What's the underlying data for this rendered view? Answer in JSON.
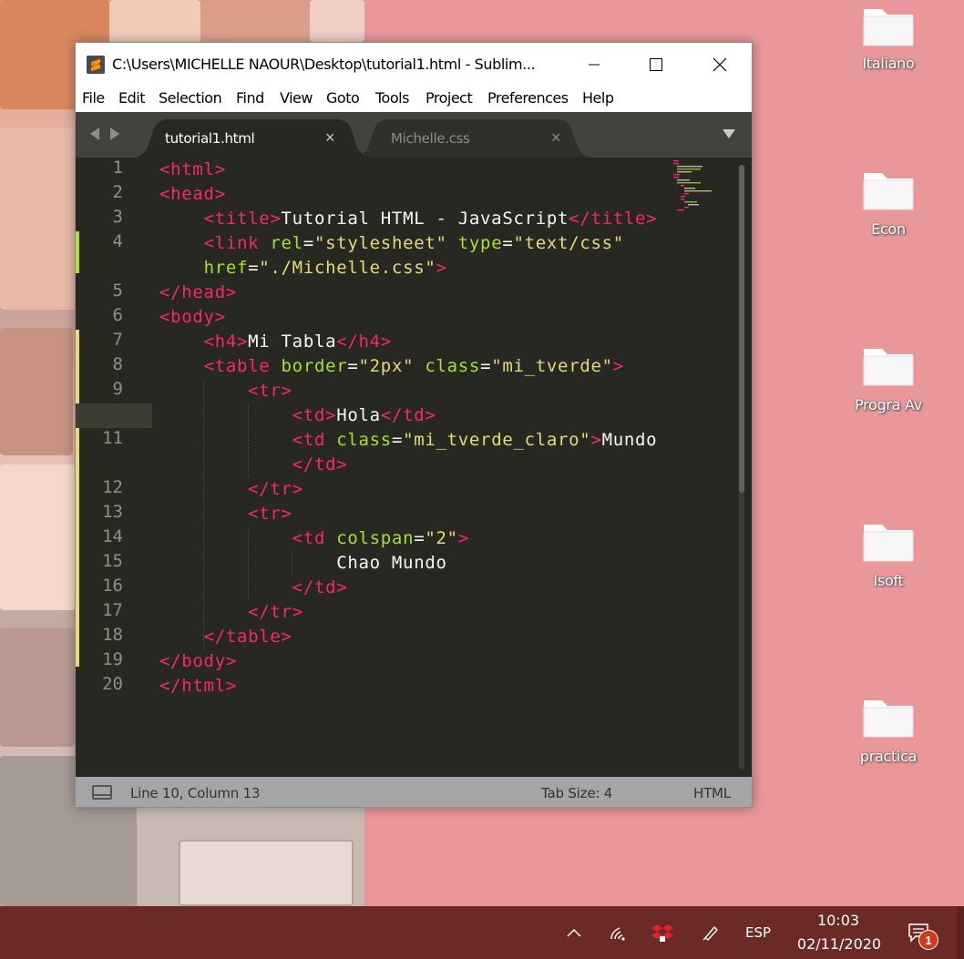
{
  "window": {
    "title": "C:\\Users\\MICHELLE NAOUR\\Desktop\\tutorial1.html - Sublim...",
    "menu": [
      "File",
      "Edit",
      "Selection",
      "Find",
      "View",
      "Goto",
      "Tools",
      "Project",
      "Preferences",
      "Help"
    ]
  },
  "tabs": [
    {
      "label": "tutorial1.html",
      "active": true
    },
    {
      "label": "Michelle.css",
      "active": false
    }
  ],
  "editor": {
    "line_numbers": [
      "1",
      "2",
      "3",
      "4",
      "",
      "5",
      "6",
      "7",
      "8",
      "9",
      "10",
      "11",
      "",
      "12",
      "13",
      "14",
      "15",
      "16",
      "17",
      "18",
      "19",
      "20"
    ],
    "current_line": "10",
    "lines": [
      [
        [
          "tag",
          "<"
        ],
        [
          "tagname",
          "html"
        ],
        [
          "tag",
          ">"
        ]
      ],
      [
        [
          "tag",
          "<"
        ],
        [
          "tagname",
          "head"
        ],
        [
          "tag",
          ">"
        ]
      ],
      [
        [
          "txt",
          "    "
        ],
        [
          "tag",
          "<"
        ],
        [
          "tagname",
          "title"
        ],
        [
          "tag",
          ">"
        ],
        [
          "txt",
          "Tutorial HTML - JavaScript"
        ],
        [
          "tag",
          "</"
        ],
        [
          "tagname",
          "title"
        ],
        [
          "tag",
          ">"
        ]
      ],
      [
        [
          "txt",
          "    "
        ],
        [
          "tag",
          "<"
        ],
        [
          "tagname",
          "link"
        ],
        [
          "txt",
          " "
        ],
        [
          "attr",
          "rel"
        ],
        [
          "txt",
          "="
        ],
        [
          "str",
          "\"stylesheet\""
        ],
        [
          "txt",
          " "
        ],
        [
          "attr",
          "type"
        ],
        [
          "txt",
          "="
        ],
        [
          "str",
          "\"text/css\""
        ]
      ],
      [
        [
          "txt",
          "    "
        ],
        [
          "attr",
          "href"
        ],
        [
          "txt",
          "="
        ],
        [
          "str",
          "\"./Michelle.css\""
        ],
        [
          "tag",
          ">"
        ]
      ],
      [
        [
          "tag",
          "</"
        ],
        [
          "tagname",
          "head"
        ],
        [
          "tag",
          ">"
        ]
      ],
      [
        [
          "tag",
          "<"
        ],
        [
          "tagname",
          "body"
        ],
        [
          "tag",
          ">"
        ]
      ],
      [
        [
          "txt",
          "    "
        ],
        [
          "tag",
          "<"
        ],
        [
          "tagname",
          "h4"
        ],
        [
          "tag",
          ">"
        ],
        [
          "txt",
          "Mi Tabla"
        ],
        [
          "tag",
          "</"
        ],
        [
          "tagname",
          "h4"
        ],
        [
          "tag",
          ">"
        ]
      ],
      [
        [
          "txt",
          "    "
        ],
        [
          "tag",
          "<"
        ],
        [
          "tagname",
          "table"
        ],
        [
          "txt",
          " "
        ],
        [
          "attr",
          "border"
        ],
        [
          "txt",
          "="
        ],
        [
          "str",
          "\"2px\""
        ],
        [
          "txt",
          " "
        ],
        [
          "attr",
          "class"
        ],
        [
          "txt",
          "="
        ],
        [
          "str",
          "\"mi_tverde\""
        ],
        [
          "tag",
          ">"
        ]
      ],
      [
        [
          "txt",
          "        "
        ],
        [
          "tag",
          "<"
        ],
        [
          "tagname",
          "tr"
        ],
        [
          "tag",
          ">"
        ]
      ],
      [
        [
          "txt",
          "            "
        ],
        [
          "tag",
          "<"
        ],
        [
          "tagname",
          "td"
        ],
        [
          "tag",
          ">"
        ],
        [
          "txt",
          "Hola"
        ],
        [
          "tag",
          "</"
        ],
        [
          "tagname",
          "td"
        ],
        [
          "tag",
          ">"
        ]
      ],
      [
        [
          "txt",
          "            "
        ],
        [
          "tag",
          "<"
        ],
        [
          "tagname",
          "td"
        ],
        [
          "txt",
          " "
        ],
        [
          "attr",
          "class"
        ],
        [
          "txt",
          "="
        ],
        [
          "str",
          "\"mi_tverde_claro\""
        ],
        [
          "tag",
          ">"
        ],
        [
          "txt",
          "Mundo"
        ]
      ],
      [
        [
          "txt",
          "            "
        ],
        [
          "tag",
          "</"
        ],
        [
          "tagname",
          "td"
        ],
        [
          "tag",
          ">"
        ]
      ],
      [
        [
          "txt",
          "        "
        ],
        [
          "tag",
          "</"
        ],
        [
          "tagname",
          "tr"
        ],
        [
          "tag",
          ">"
        ]
      ],
      [
        [
          "txt",
          "        "
        ],
        [
          "tag",
          "<"
        ],
        [
          "tagname",
          "tr"
        ],
        [
          "tag",
          ">"
        ]
      ],
      [
        [
          "txt",
          "            "
        ],
        [
          "tag",
          "<"
        ],
        [
          "tagname",
          "td"
        ],
        [
          "txt",
          " "
        ],
        [
          "attr",
          "colspan"
        ],
        [
          "txt",
          "="
        ],
        [
          "str",
          "\"2\""
        ],
        [
          "tag",
          ">"
        ]
      ],
      [
        [
          "txt",
          "                Chao Mundo"
        ]
      ],
      [
        [
          "txt",
          "            "
        ],
        [
          "tag",
          "</"
        ],
        [
          "tagname",
          "td"
        ],
        [
          "tag",
          ">"
        ]
      ],
      [
        [
          "txt",
          "        "
        ],
        [
          "tag",
          "</"
        ],
        [
          "tagname",
          "tr"
        ],
        [
          "tag",
          ">"
        ]
      ],
      [
        [
          "txt",
          "    "
        ],
        [
          "tag",
          "</"
        ],
        [
          "tagname",
          "table"
        ],
        [
          "tag",
          ">"
        ]
      ],
      [
        [
          "tag",
          "</"
        ],
        [
          "tagname",
          "body"
        ],
        [
          "tag",
          ">"
        ]
      ],
      [
        [
          "tag",
          "</"
        ],
        [
          "tagname",
          "html"
        ],
        [
          "tag",
          ">"
        ]
      ]
    ]
  },
  "status": {
    "position": "Line 10, Column 13",
    "tab_size": "Tab Size: 4",
    "syntax": "HTML"
  },
  "desktop_icons": [
    "Italiano",
    "Econ",
    "Progra Av",
    "Isoft",
    "practica"
  ],
  "taskbar": {
    "language": "ESP",
    "time": "10:03",
    "date": "02/11/2020",
    "notifications": "1"
  },
  "colors": {
    "desktop_bg": "#e9979a",
    "editor_bg": "#272822",
    "tag": "#f92672",
    "attr": "#a6e22e",
    "string": "#e6db74",
    "text": "#f8f8f2",
    "taskbar": "#6b2a26"
  }
}
